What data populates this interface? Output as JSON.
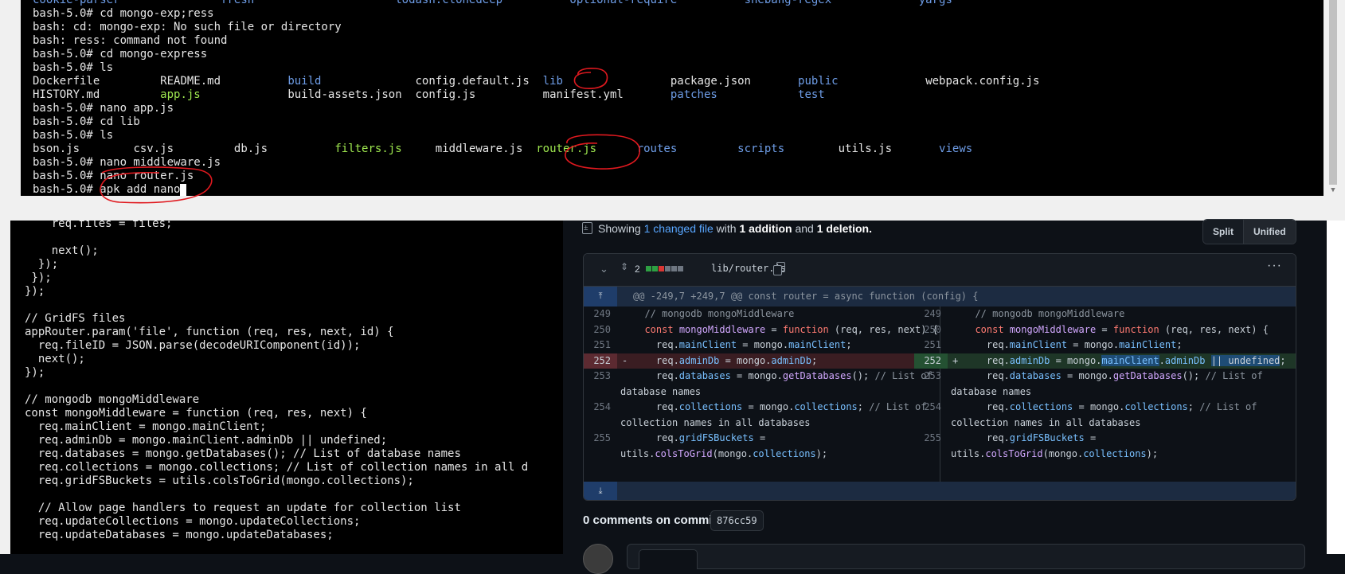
{
  "terminal": {
    "lines": [
      {
        "segments": [
          {
            "text": "cookie-parser",
            "cls": "b",
            "col": 0
          },
          {
            "text": "fresh",
            "cls": "b",
            "col": 28
          },
          {
            "text": "lodash.clonedeep",
            "cls": "b",
            "col": 54
          },
          {
            "text": "optional-require",
            "cls": "b",
            "col": 80
          },
          {
            "text": "shebang-regex",
            "cls": "b",
            "col": 106
          },
          {
            "text": "yargs",
            "cls": "b",
            "col": 132
          }
        ]
      },
      {
        "segments": [
          {
            "text": "bash-5.0# cd mongo-exp;ress",
            "cls": "",
            "col": 0
          }
        ]
      },
      {
        "segments": [
          {
            "text": "bash: cd: mongo-exp: No such file or directory",
            "cls": "",
            "col": 0
          }
        ]
      },
      {
        "segments": [
          {
            "text": "bash: ress: command not found",
            "cls": "",
            "col": 0
          }
        ]
      },
      {
        "segments": [
          {
            "text": "bash-5.0# cd mongo-express",
            "cls": "",
            "col": 0
          }
        ]
      },
      {
        "segments": [
          {
            "text": "bash-5.0# ls",
            "cls": "",
            "col": 0
          }
        ]
      },
      {
        "segments": [
          {
            "text": "Dockerfile",
            "cls": "",
            "col": 0
          },
          {
            "text": "README.md",
            "cls": "",
            "col": 19
          },
          {
            "text": "build",
            "cls": "b",
            "col": 38
          },
          {
            "text": "config.default.js",
            "cls": "",
            "col": 57
          },
          {
            "text": "lib",
            "cls": "b",
            "col": 76
          },
          {
            "text": "package.json",
            "cls": "",
            "col": 95
          },
          {
            "text": "public",
            "cls": "b",
            "col": 114
          },
          {
            "text": "webpack.config.js",
            "cls": "",
            "col": 133
          }
        ]
      },
      {
        "segments": [
          {
            "text": "HISTORY.md",
            "cls": "",
            "col": 0
          },
          {
            "text": "app.js",
            "cls": "g",
            "col": 19
          },
          {
            "text": "build-assets.json",
            "cls": "",
            "col": 38
          },
          {
            "text": "config.js",
            "cls": "",
            "col": 57
          },
          {
            "text": "manifest.yml",
            "cls": "",
            "col": 76
          },
          {
            "text": "patches",
            "cls": "b",
            "col": 95
          },
          {
            "text": "test",
            "cls": "b",
            "col": 114
          }
        ]
      },
      {
        "segments": [
          {
            "text": "bash-5.0# nano app.js",
            "cls": "",
            "col": 0
          }
        ]
      },
      {
        "segments": [
          {
            "text": "bash-5.0# cd lib",
            "cls": "",
            "col": 0
          }
        ]
      },
      {
        "segments": [
          {
            "text": "bash-5.0# ls",
            "cls": "",
            "col": 0
          }
        ]
      },
      {
        "segments": [
          {
            "text": "bson.js",
            "cls": "",
            "col": 0
          },
          {
            "text": "csv.js",
            "cls": "",
            "col": 15
          },
          {
            "text": "db.js",
            "cls": "",
            "col": 30
          },
          {
            "text": "filters.js",
            "cls": "g",
            "col": 45
          },
          {
            "text": "middleware.js",
            "cls": "",
            "col": 60
          },
          {
            "text": "router.js",
            "cls": "g",
            "col": 75
          },
          {
            "text": "routes",
            "cls": "b",
            "col": 90
          },
          {
            "text": "scripts",
            "cls": "b",
            "col": 105
          },
          {
            "text": "utils.js",
            "cls": "",
            "col": 120
          },
          {
            "text": "views",
            "cls": "b",
            "col": 135
          }
        ]
      },
      {
        "segments": [
          {
            "text": "bash-5.0# nano middleware.js",
            "cls": "",
            "col": 0
          }
        ]
      },
      {
        "segments": [
          {
            "text": "bash-5.0# nano router.js",
            "cls": "",
            "col": 0
          }
        ]
      },
      {
        "segments": [
          {
            "text": "bash-5.0# apk add nano",
            "cls": "",
            "col": 0
          }
        ],
        "cursor": true
      }
    ]
  },
  "editor": {
    "lines": [
      "    req.files = files;",
      "",
      "    next();",
      "  });",
      " });",
      "});",
      "",
      "// GridFS files",
      "appRouter.param('file', function (req, res, next, id) {",
      "  req.fileID = JSON.parse(decodeURIComponent(id));",
      "  next();",
      "});",
      "",
      "// mongodb mongoMiddleware",
      "const mongoMiddleware = function (req, res, next) {",
      "  req.mainClient = mongo.mainClient;",
      "  req.adminDb = mongo.mainClient.adminDb || undefined;",
      "  req.databases = mongo.getDatabases(); // List of database names",
      "  req.collections = mongo.collections; // List of collection names in all d",
      "  req.gridFSBuckets = utils.colsToGrid(mongo.collections);",
      "",
      "  // Allow page handlers to request an update for collection list",
      "  req.updateCollections = mongo.updateCollections;",
      "  req.updateDatabases = mongo.updateDatabases;"
    ]
  },
  "github": {
    "summary": {
      "showing": "Showing",
      "changed": "1 changed file",
      "with": "with",
      "additions": "1 addition",
      "and": "and",
      "deletions": "1 deletion."
    },
    "view_toggle": {
      "split": "Split",
      "unified": "Unified"
    },
    "file": {
      "count": "2",
      "name": "lib/router.js",
      "diffstat_colors": [
        "#2ea043",
        "#2ea043",
        "#da3633",
        "#6e7681",
        "#6e7681",
        "#6e7681"
      ]
    },
    "hunk_header": "@@ -249,7 +249,7 @@ const router = async function (config) {",
    "left": [
      {
        "n": "249",
        "t": "  // mongodb mongoMiddleware",
        "kind": "ctx",
        "lines": 1
      },
      {
        "n": "250",
        "t": "  const mongoMiddleware = function (req, res, next) {",
        "kind": "ctx",
        "lines": 1
      },
      {
        "n": "251",
        "t": "    req.mainClient = mongo.mainClient;",
        "kind": "ctx",
        "lines": 1
      },
      {
        "n": "252",
        "t": "    req.adminDb = mongo.adminDb;",
        "kind": "del",
        "mark": "-",
        "lines": 1
      },
      {
        "n": "253",
        "t": "    req.databases = mongo.getDatabases(); // List of",
        "t2": "database names",
        "kind": "ctx",
        "lines": 2
      },
      {
        "n": "254",
        "t": "    req.collections = mongo.collections; // List of",
        "t2": "collection names in all databases",
        "kind": "ctx",
        "lines": 2
      },
      {
        "n": "255",
        "t": "    req.gridFSBuckets =",
        "t2": "utils.colsToGrid(mongo.collections);",
        "kind": "ctx",
        "lines": 2
      }
    ],
    "right": [
      {
        "n": "249",
        "t": "  // mongodb mongoMiddleware",
        "kind": "ctx",
        "lines": 1
      },
      {
        "n": "250",
        "t": "  const mongoMiddleware = function (req, res, next) {",
        "kind": "ctx",
        "lines": 1
      },
      {
        "n": "251",
        "t": "    req.mainClient = mongo.mainClient;",
        "kind": "ctx",
        "lines": 1
      },
      {
        "n": "252",
        "t": "    req.adminDb = mongo.mainClient.adminDb || undefined;",
        "kind": "add",
        "mark": "+",
        "lines": 1
      },
      {
        "n": "253",
        "t": "    req.databases = mongo.getDatabases(); // List of",
        "t2": "database names",
        "kind": "ctx",
        "lines": 2
      },
      {
        "n": "254",
        "t": "    req.collections = mongo.collections; // List of",
        "t2": "collection names in all databases",
        "kind": "ctx",
        "lines": 2
      },
      {
        "n": "255",
        "t": "    req.gridFSBuckets =",
        "t2": "utils.colsToGrid(mongo.collections);",
        "kind": "ctx",
        "lines": 2
      }
    ],
    "comments_heading": "0 comments on commit",
    "commit_sha": "876cc59"
  },
  "colors": {
    "annotation": "#e0191f",
    "addition": "#2ea043",
    "deletion": "#da3633",
    "link": "#58a6ff"
  }
}
